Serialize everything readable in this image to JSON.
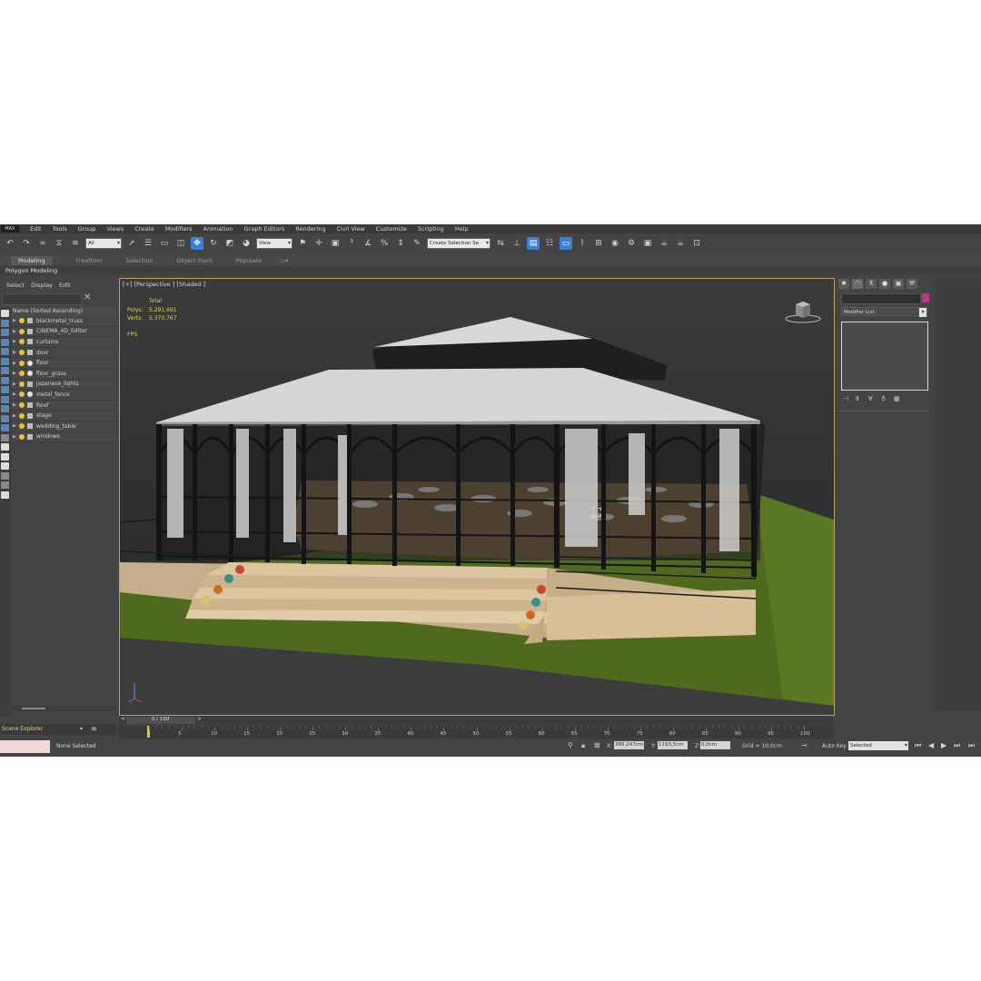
{
  "app": {
    "logo": "MAX",
    "menu": [
      "Edit",
      "Tools",
      "Group",
      "Views",
      "Create",
      "Modifiers",
      "Animation",
      "Graph Editors",
      "Rendering",
      "Civil View",
      "Customize",
      "Scripting",
      "Help"
    ]
  },
  "toolbar": {
    "filter_value": "All",
    "ref_coord_value": "View",
    "selection_set_value": "Create Selection Se"
  },
  "ribbon": {
    "tabs": [
      "Modeling",
      "Freeform",
      "Selection",
      "Object Paint",
      "Populate"
    ],
    "active_tab": "Modeling",
    "sub_label": "Polygon Modeling"
  },
  "scene_explorer": {
    "menu": [
      "Select",
      "Display",
      "Edit"
    ],
    "header": "Name (Sorted Ascending)",
    "items": [
      {
        "name": "blackmetal_truss",
        "type": "mesh"
      },
      {
        "name": "CINEMA_4D_Editor",
        "type": "camera"
      },
      {
        "name": "curtains",
        "type": "mesh"
      },
      {
        "name": "door",
        "type": "mesh"
      },
      {
        "name": "floor",
        "type": "sphere"
      },
      {
        "name": "floor_grass",
        "type": "sphere"
      },
      {
        "name": "japanese_lights",
        "type": "mesh"
      },
      {
        "name": "metal_fence",
        "type": "sphere"
      },
      {
        "name": "Roof",
        "type": "mesh"
      },
      {
        "name": "stage",
        "type": "mesh"
      },
      {
        "name": "wedding_table",
        "type": "mesh"
      },
      {
        "name": "windows",
        "type": "mesh"
      }
    ],
    "footer_label": "Scene Explorer"
  },
  "viewport": {
    "label": "[+] [Perspective ] [Shaded ]",
    "stats": {
      "total_label": "Total",
      "polys_label": "Polys:",
      "polys_value": "5.291.691",
      "verts_label": "Verts:",
      "verts_value": "5.370.767",
      "fps_label": "FPS:"
    }
  },
  "command_panel": {
    "modifier_list": "Modifier List"
  },
  "timeline": {
    "frame_display": "0 / 100",
    "prev": "<",
    "next": ">",
    "ticks": [
      "0",
      "5",
      "10",
      "15",
      "20",
      "25",
      "30",
      "35",
      "40",
      "45",
      "50",
      "55",
      "60",
      "65",
      "70",
      "75",
      "80",
      "85",
      "90",
      "95",
      "100"
    ]
  },
  "status": {
    "selection": "None Selected",
    "x_label": "X:",
    "x_value": "366,247cm",
    "y_label": "Y:",
    "y_value": "1193,5cm",
    "z_label": "Z:",
    "z_value": "0,0cm",
    "grid": "Grid = 10,0cm",
    "auto_key_label": "Auto Key",
    "key_filter": "Selected"
  },
  "colors": {
    "ui_bg": "#444444",
    "active_blue": "#3c7fd6",
    "viewport_border": "#b8a460",
    "stats_text": "#e0d45a",
    "object_color": "#c0388a"
  }
}
